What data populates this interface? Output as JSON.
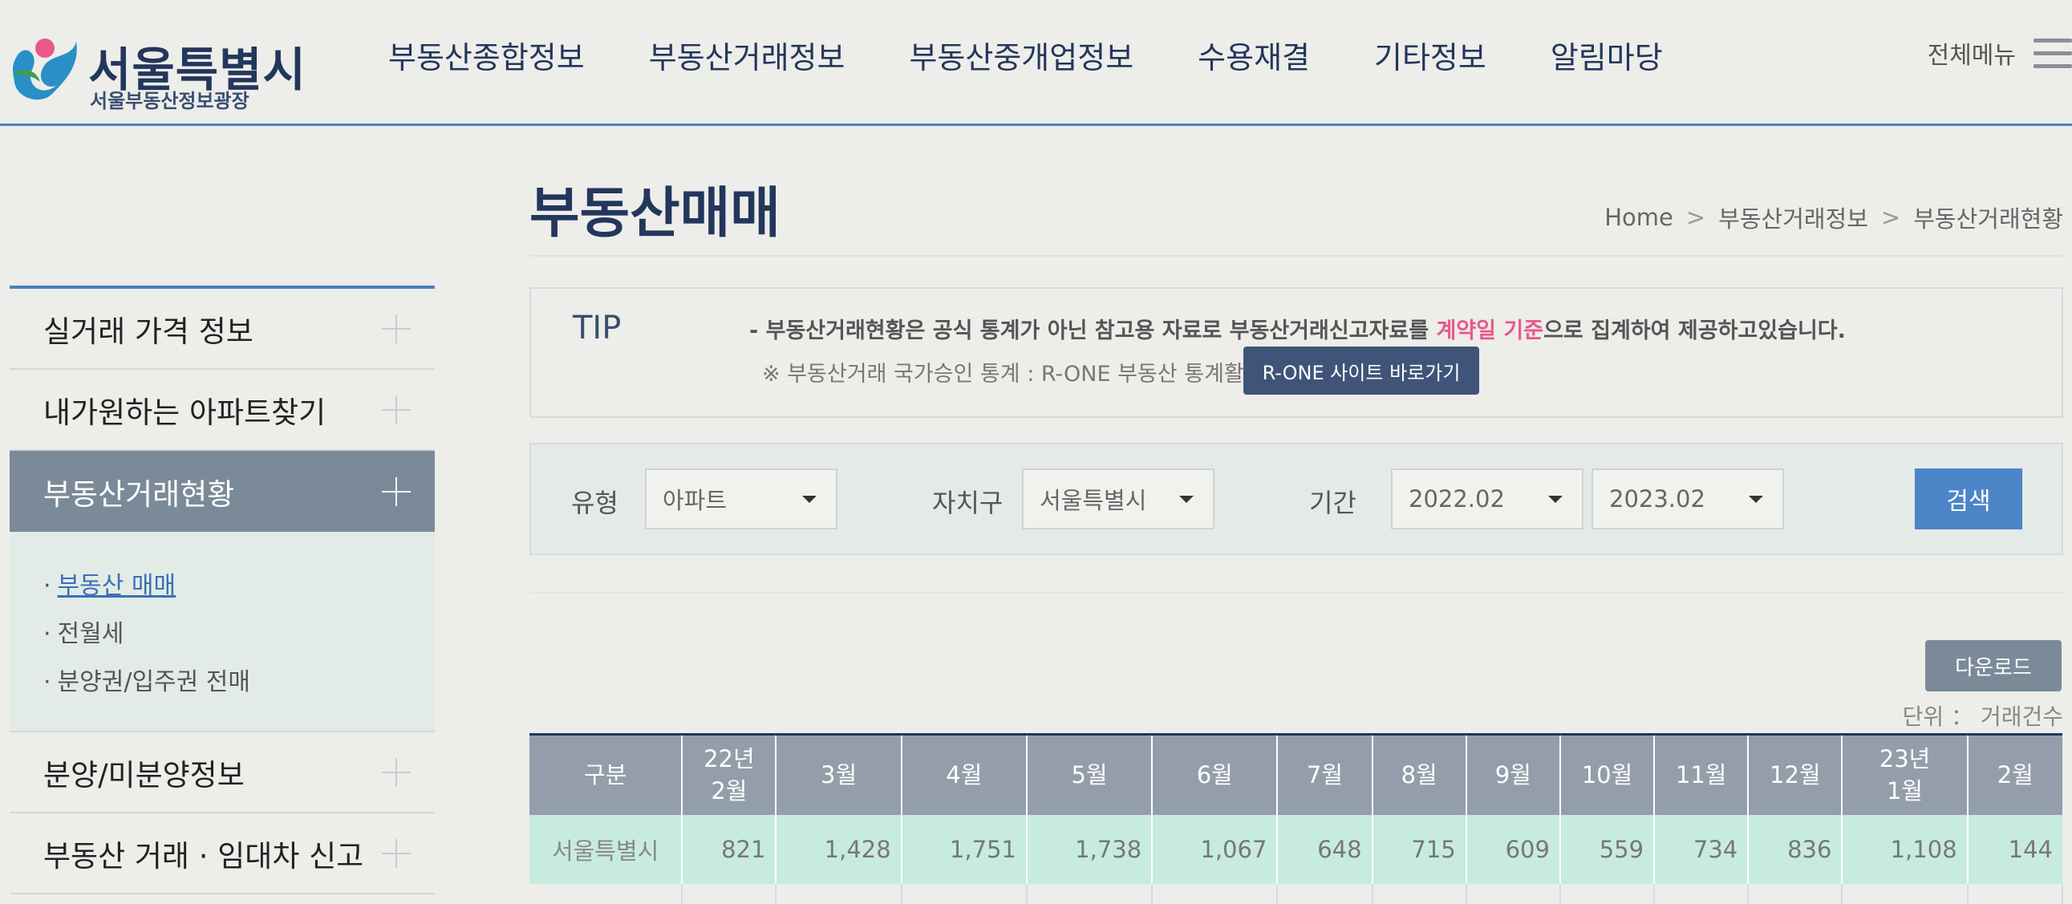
{
  "header": {
    "logo_title": "서울특별시",
    "logo_subtitle": "서울부동산정보광장",
    "nav": [
      "부동산종합정보",
      "부동산거래정보",
      "부동산중개업정보",
      "수용재결",
      "기타정보",
      "알림마당"
    ],
    "all_menu": "전체메뉴"
  },
  "sidebar": {
    "items": [
      {
        "label": "실거래 가격 정보"
      },
      {
        "label": "내가원하는 아파트찾기"
      },
      {
        "label": "부동산거래현황"
      },
      {
        "label": "분양/미분양정보"
      },
      {
        "label": "부동산 거래 · 임대차 신고"
      }
    ],
    "sub_items": [
      "부동산 매매",
      "전월세",
      "분양권/입주권 전매"
    ],
    "sub_bullet": "·"
  },
  "main": {
    "title": "부동산매매",
    "breadcrumb": [
      "Home",
      "부동산거래정보",
      "부동산거래현황"
    ],
    "breadcrumb_sep": ">",
    "tip": {
      "label": "TIP",
      "line1_prefix": "-  부동산거래현황은 공식 통계가 아닌 참고용 자료로 부동산거래신고자료를 ",
      "line1_highlight": "계약일 기준",
      "line1_suffix": "으로 집계하여 제공하고있습니다.",
      "line2": "※ 부동산거래 국가승인 통계 : R-ONE 부동산 통계활용",
      "rone_button": "R-ONE 사이트 바로가기"
    },
    "search": {
      "type_label": "유형",
      "type_value": "아파트",
      "district_label": "자치구",
      "district_value": "서울특별시",
      "period_label": "기간",
      "period_from": "2022.02",
      "period_to": "2023.02",
      "search_button": "검색"
    },
    "download_button": "다운로드",
    "unit": "단위 ： 거래건수",
    "table": {
      "headers": [
        "구분",
        "22년\n2월",
        "3월",
        "4월",
        "5월",
        "6월",
        "7월",
        "8월",
        "9월",
        "10월",
        "11월",
        "12월",
        "23년\n1월",
        "2월"
      ],
      "rows": [
        [
          "서울특별시",
          "821",
          "1,428",
          "1,751",
          "1,738",
          "1,067",
          "648",
          "715",
          "609",
          "559",
          "734",
          "836",
          "1,108",
          "144"
        ]
      ]
    }
  },
  "colors": {
    "accent_blue": "#4a7fc1",
    "navy": "#23365c",
    "highlight_pink": "#e8588a",
    "table_header": "#939eaa",
    "table_row": "#c7ebe0"
  }
}
